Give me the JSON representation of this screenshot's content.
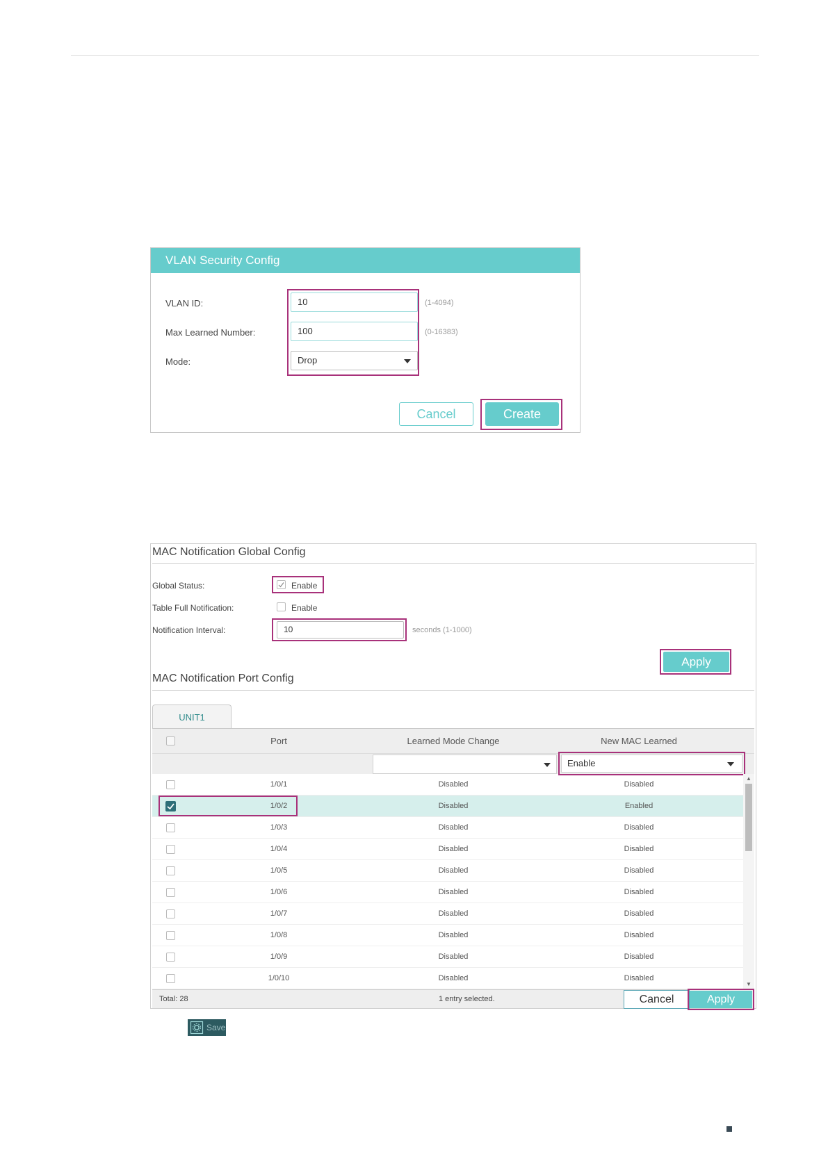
{
  "vlan_security": {
    "title": "VLAN Security Config",
    "vlan_id": {
      "label": "VLAN ID:",
      "value": "10",
      "hint": "(1-4094)"
    },
    "max_learned": {
      "label": "Max Learned Number:",
      "value": "100",
      "hint": "(0-16383)"
    },
    "mode": {
      "label": "Mode:",
      "value": "Drop"
    },
    "cancel_label": "Cancel",
    "create_label": "Create"
  },
  "mac_global": {
    "title": "MAC Notification Global Config",
    "global_status": {
      "label": "Global Status:",
      "option": "Enable",
      "checked": true
    },
    "table_full": {
      "label": "Table Full Notification:",
      "option": "Enable",
      "checked": false
    },
    "interval": {
      "label": "Notification Interval:",
      "value": "10",
      "hint": "seconds (1-1000)"
    },
    "apply_label": "Apply"
  },
  "mac_port": {
    "title": "MAC Notification Port Config",
    "tab_label": "UNIT1",
    "columns": [
      "Port",
      "Learned Mode Change",
      "New MAC Learned"
    ],
    "filter": {
      "learned_mode_change": "",
      "new_mac_learned": "Enable"
    },
    "rows": [
      {
        "port": "1/0/1",
        "learned_mode_change": "Disabled",
        "new_mac_learned": "Disabled",
        "selected": false
      },
      {
        "port": "1/0/2",
        "learned_mode_change": "Disabled",
        "new_mac_learned": "Enabled",
        "selected": true
      },
      {
        "port": "1/0/3",
        "learned_mode_change": "Disabled",
        "new_mac_learned": "Disabled",
        "selected": false
      },
      {
        "port": "1/0/4",
        "learned_mode_change": "Disabled",
        "new_mac_learned": "Disabled",
        "selected": false
      },
      {
        "port": "1/0/5",
        "learned_mode_change": "Disabled",
        "new_mac_learned": "Disabled",
        "selected": false
      },
      {
        "port": "1/0/6",
        "learned_mode_change": "Disabled",
        "new_mac_learned": "Disabled",
        "selected": false
      },
      {
        "port": "1/0/7",
        "learned_mode_change": "Disabled",
        "new_mac_learned": "Disabled",
        "selected": false
      },
      {
        "port": "1/0/8",
        "learned_mode_change": "Disabled",
        "new_mac_learned": "Disabled",
        "selected": false
      },
      {
        "port": "1/0/9",
        "learned_mode_change": "Disabled",
        "new_mac_learned": "Disabled",
        "selected": false
      },
      {
        "port": "1/0/10",
        "learned_mode_change": "Disabled",
        "new_mac_learned": "Disabled",
        "selected": false
      }
    ],
    "total": "Total: 28",
    "selection_status": "1 entry selected.",
    "cancel_label": "Cancel",
    "apply_label": "Apply"
  },
  "save": {
    "label": "Save",
    "icon": "save-gear-icon"
  }
}
